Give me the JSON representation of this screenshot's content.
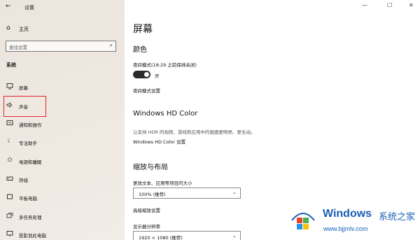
{
  "window": {
    "title": "设置",
    "controls": [
      "—",
      "☐",
      "✕"
    ]
  },
  "sidebar": {
    "home_label": "主页",
    "search_placeholder": "查找设置",
    "section_label": "系统",
    "items": [
      {
        "label": "屏幕",
        "icon": "monitor-icon"
      },
      {
        "label": "声音",
        "icon": "speaker-icon"
      },
      {
        "label": "通知和操作",
        "icon": "notification-icon"
      },
      {
        "label": "专注助手",
        "icon": "moon-icon"
      },
      {
        "label": "电源和睡眠",
        "icon": "power-icon"
      },
      {
        "label": "存储",
        "icon": "storage-icon"
      },
      {
        "label": "平板电脑",
        "icon": "tablet-icon"
      },
      {
        "label": "多任务处理",
        "icon": "multitask-icon"
      },
      {
        "label": "投影到此电脑",
        "icon": "project-icon"
      }
    ],
    "highlight_color": "#e0262a"
  },
  "main": {
    "page_title": "屏幕",
    "color_section": {
      "heading": "颜色",
      "night_mode_label": "夜间模式(18:29 之前保持关闭)",
      "toggle_text": "开",
      "toggle_on": true,
      "night_settings_link": "夜间模式设置"
    },
    "hdr_section": {
      "heading": "Windows HD Color",
      "description": "让支持 HDR 的视频、游戏和应用中的画面更明亮、更生动。",
      "settings_link": "Windows HD Color 设置"
    },
    "scale_section": {
      "heading": "缩放与布局",
      "scale_label": "更改文本、应用等项目的大小",
      "scale_value": "100% (推荐)",
      "advanced_link": "高级缩放设置",
      "resolution_label": "显示器分辨率",
      "resolution_value": "1920 × 1080 (推荐)"
    }
  },
  "watermark": {
    "title": "Windows",
    "subtitle": "系统之家",
    "url": "www.bjjmlv.com",
    "color": "#1a5fb4"
  }
}
